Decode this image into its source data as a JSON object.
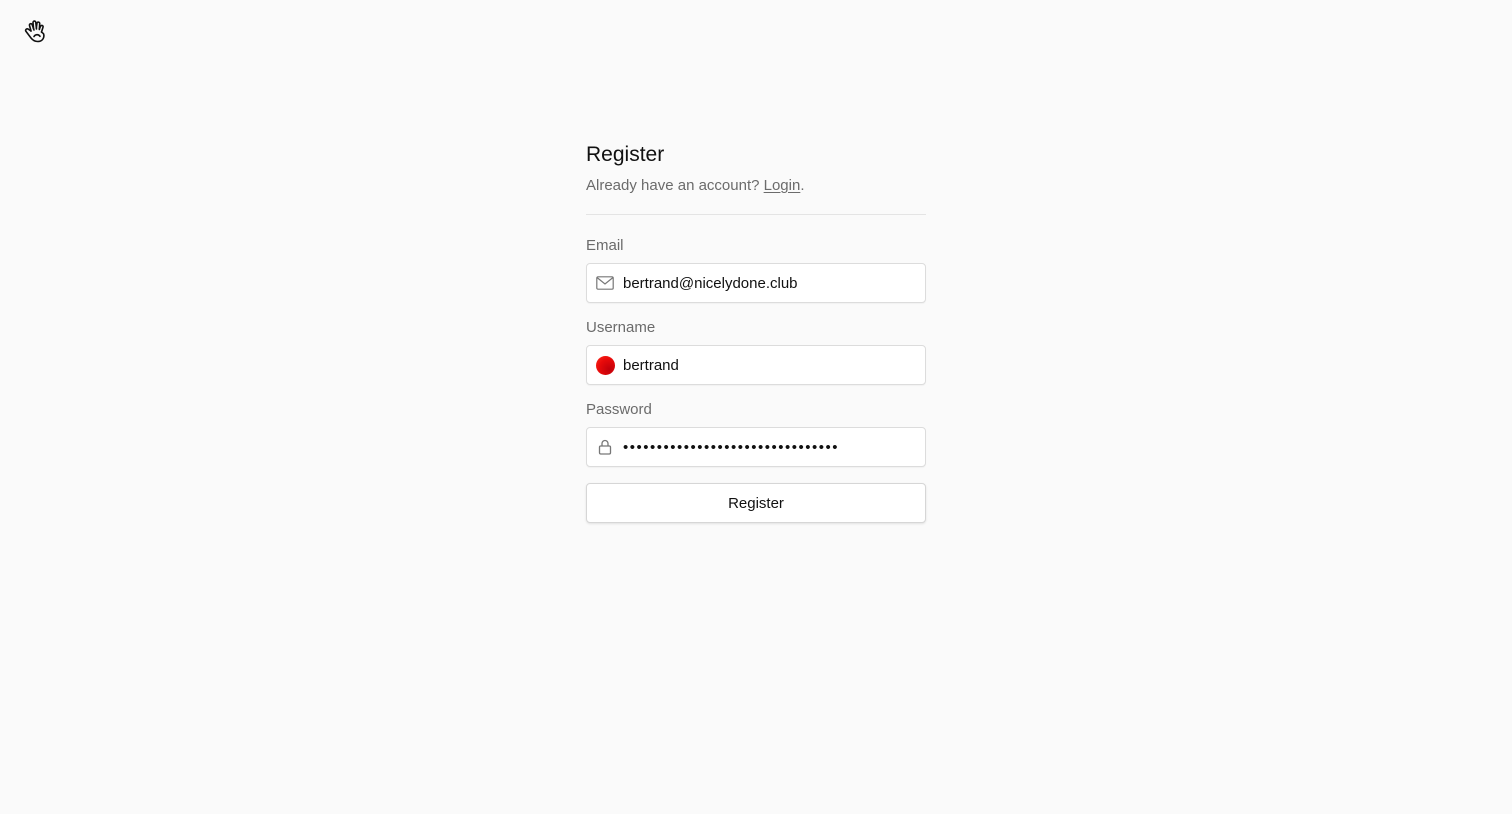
{
  "header": {
    "logo_icon": "waving-hand-icon"
  },
  "form": {
    "title": "Register",
    "subtitle_prefix": "Already have an account? ",
    "login_link": "Login",
    "subtitle_suffix": ".",
    "email": {
      "label": "Email",
      "value": "bertrand@nicelydone.club",
      "icon": "mail-icon"
    },
    "username": {
      "label": "Username",
      "value": "bertrand",
      "icon": "avatar-icon"
    },
    "password": {
      "label": "Password",
      "value": "••••••••••••••••••••••••••••••••",
      "icon": "lock-icon"
    },
    "submit_label": "Register"
  },
  "colors": {
    "background": "#fafafa",
    "avatar_red": "#e80a0a",
    "muted_text": "#6b6b6b"
  }
}
